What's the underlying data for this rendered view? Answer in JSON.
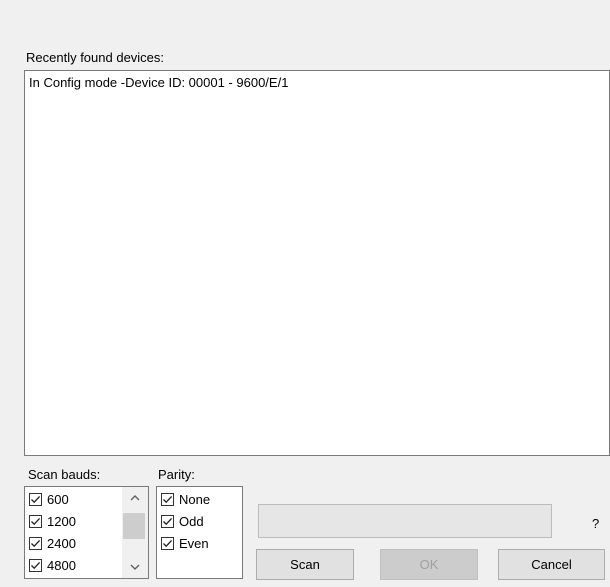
{
  "devices": {
    "label": "Recently found devices:",
    "items": [
      "In Config mode -Device ID: 00001 - 9600/E/1"
    ]
  },
  "scan_bauds": {
    "label": "Scan bauds:",
    "items": [
      {
        "label": "600",
        "checked": true
      },
      {
        "label": "1200",
        "checked": true
      },
      {
        "label": "2400",
        "checked": true
      },
      {
        "label": "4800",
        "checked": true
      }
    ],
    "scroll_up_icon": "chevron-up-icon",
    "scroll_down_icon": "chevron-down-icon"
  },
  "parity": {
    "label": "Parity:",
    "items": [
      {
        "label": "None",
        "checked": true
      },
      {
        "label": "Odd",
        "checked": true
      },
      {
        "label": "Even",
        "checked": true
      }
    ]
  },
  "help_text": "?",
  "buttons": {
    "scan": "Scan",
    "ok": "OK",
    "cancel": "Cancel"
  }
}
